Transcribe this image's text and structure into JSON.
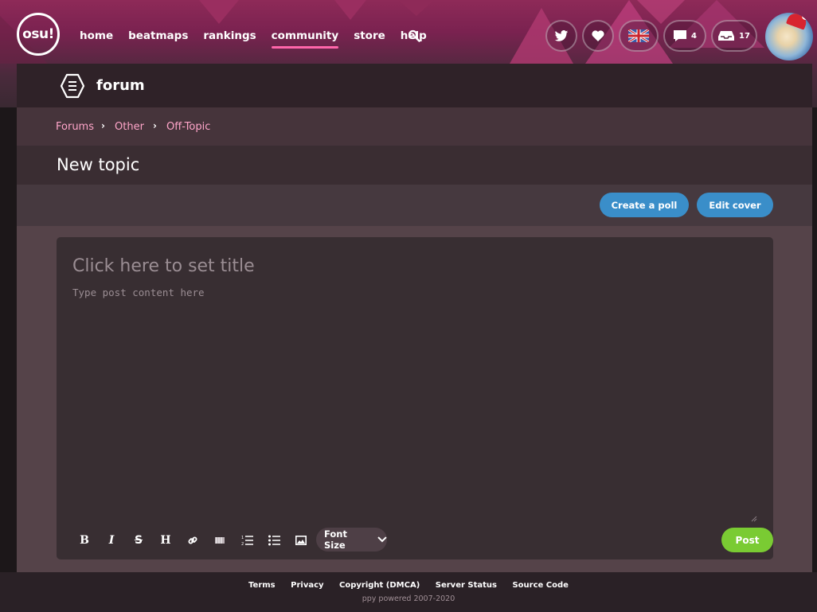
{
  "nav": {
    "logo": "osu!",
    "links": [
      "home",
      "beatmaps",
      "rankings",
      "community",
      "store",
      "help"
    ],
    "active": "community",
    "chat_count": "4",
    "notifications_count": "17"
  },
  "section": {
    "title": "forum"
  },
  "breadcrumb": [
    "Forums",
    "Other",
    "Off-Topic"
  ],
  "page_title": "New topic",
  "actions": {
    "create_poll": "Create a poll",
    "edit_cover": "Edit cover"
  },
  "editor": {
    "title_placeholder": "Click here to set title",
    "body_placeholder": "Type post content here",
    "toolbar": [
      "bold-icon",
      "italic-icon",
      "strikethrough-icon",
      "heading-icon",
      "link-icon",
      "spoiler-icon",
      "ordered-list-icon",
      "unordered-list-icon",
      "image-icon"
    ],
    "font_size_label": "Font Size",
    "post_label": "Post"
  },
  "footer": {
    "links": [
      "Terms",
      "Privacy",
      "Copyright (DMCA)",
      "Server Status",
      "Source Code"
    ],
    "powered": "ppy powered 2007-2020"
  },
  "colors": {
    "accent_pink": "#ff66aa",
    "button_blue": "#3a8ec9",
    "post_green": "#7acb33"
  }
}
